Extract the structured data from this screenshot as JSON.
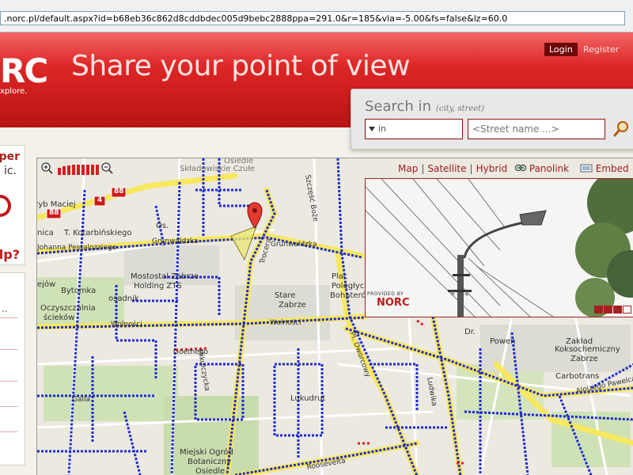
{
  "browser": {
    "url": ".norc.pl/default.aspx?id=b68eb36c862d8cddbdec005d9bebc2888ppa=291.0&r=185&vla=-5.00&fs=false&lz=60.0"
  },
  "header": {
    "logo_text": "RC",
    "logo_sub": "xplore.",
    "tagline": "Share your point of view",
    "login_label": "Login",
    "register_label": "Register"
  },
  "left_panel": {
    "card_title_1": "pper",
    "card_title_2": "ic.",
    "help_text": "elp?",
    "ellipsis": ".."
  },
  "search": {
    "title": "Search in",
    "hint": "(city, street)",
    "city_value": "in",
    "street_placeholder": "<Street name ...>"
  },
  "map": {
    "types": [
      "Map",
      "Satellite",
      "Hybrid"
    ],
    "panolink_label": "Panolink",
    "embed_label": "Embed",
    "road_badges": [
      "88",
      "4",
      "88"
    ],
    "labels": [
      "zyb Maciej",
      "nica",
      "T. Kotarbińskiego",
      "Os.",
      "Johanna Pestalozziego",
      "Grunwaldzka",
      "Grunwaldzka",
      "Mostostal Zabrze",
      "Holding ZTS",
      "Bytomka",
      "osadnik",
      "Oczyszczalnia",
      "ścieków",
      "Wolności",
      "Wolności",
      "Stare",
      "Zabrze",
      "Plac",
      "Poległych",
      "Bohaterów",
      "Szczęść Boże",
      "Trocera",
      "Pl. Dworcowy",
      "Goethego",
      "Ludwika",
      "Dr.",
      "Powen",
      "Zakład",
      "Koksochemiczny",
      "Zabrze",
      "Carbotrans",
      "Alojzego Pawelca",
      "Lukudrut",
      "Miejski Ogród",
      "Botaniczny",
      "Osiedle",
      "Galla",
      "Mikulczycka",
      "Roosevelta",
      "Osiedle",
      "Składowiskie Czułe",
      "ejów"
    ]
  },
  "photo": {
    "provided_by": "PROVIDED BY",
    "brand": "NORC"
  }
}
